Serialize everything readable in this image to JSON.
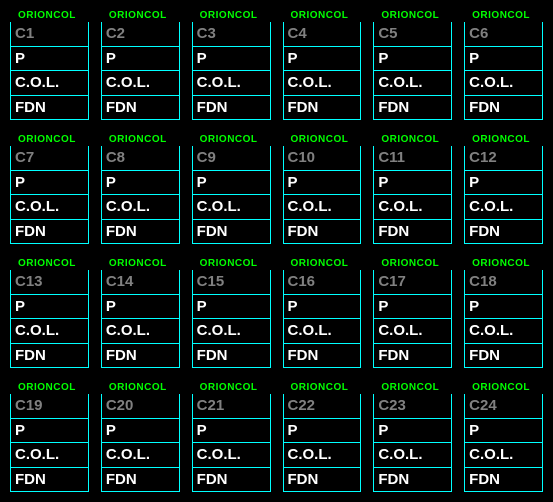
{
  "header_label": "ORIONCOL",
  "field_labels": [
    "P",
    "C.O.L.",
    "FDN"
  ],
  "blocks": [
    {
      "title": "C1"
    },
    {
      "title": "C2"
    },
    {
      "title": "C3"
    },
    {
      "title": "C4"
    },
    {
      "title": "C5"
    },
    {
      "title": "C6"
    },
    {
      "title": "C7"
    },
    {
      "title": "C8"
    },
    {
      "title": "C9"
    },
    {
      "title": "C10"
    },
    {
      "title": "C11"
    },
    {
      "title": "C12"
    },
    {
      "title": "C13"
    },
    {
      "title": "C14"
    },
    {
      "title": "C15"
    },
    {
      "title": "C16"
    },
    {
      "title": "C17"
    },
    {
      "title": "C18"
    },
    {
      "title": "C19"
    },
    {
      "title": "C20"
    },
    {
      "title": "C21"
    },
    {
      "title": "C22"
    },
    {
      "title": "C23"
    },
    {
      "title": "C24"
    }
  ]
}
